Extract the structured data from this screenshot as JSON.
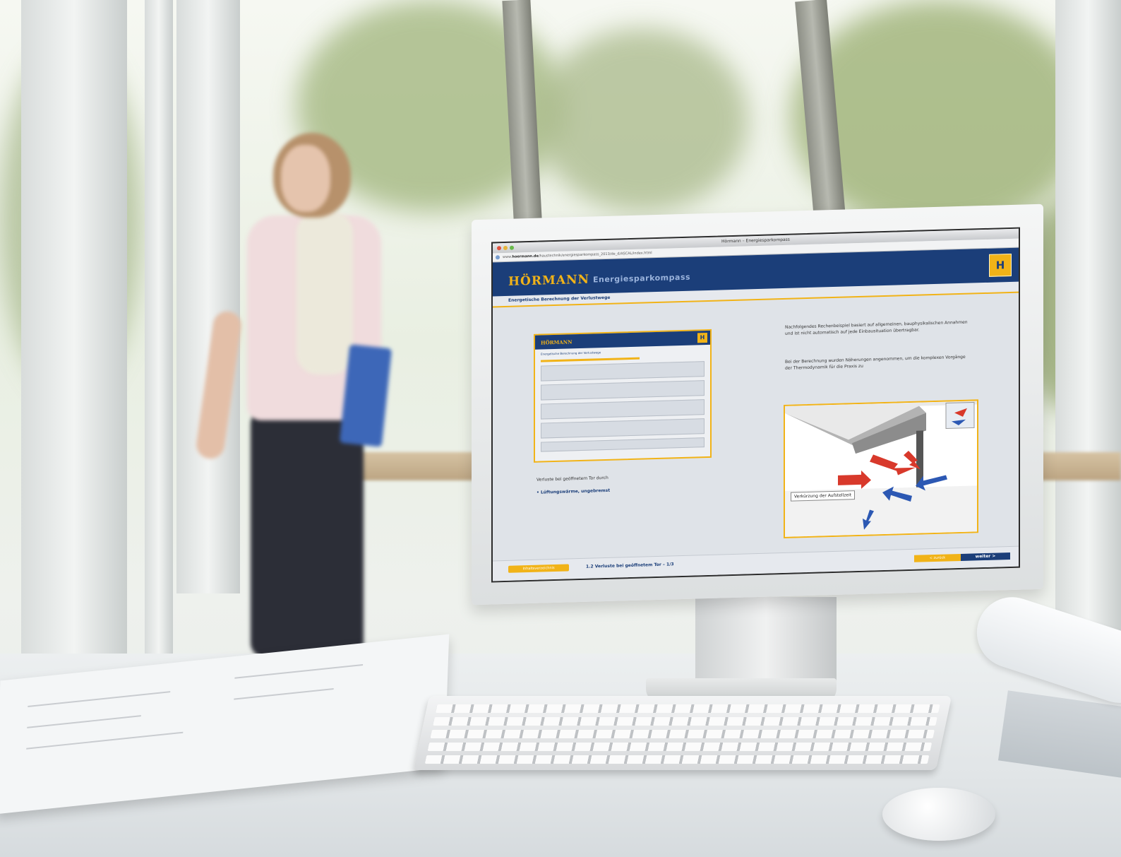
{
  "browser": {
    "window_title": "Hörmann – Energiesparkompass",
    "url_prefix": "www.",
    "url_domain": "hoermann.de",
    "url_path": "/haustechnik/energiesparkompass_2013/de_d/ASCAL/index.html"
  },
  "app": {
    "brand": "HÖRMANN",
    "product": "Energiesparkompass",
    "logo_glyph": "H",
    "section_title": "Energetische Berechnung der Verlustwege",
    "thumbnail": {
      "brand": "HÖRMANN",
      "logo_glyph": "H",
      "title": "Energetische Berechnung der Verlustwege"
    },
    "loss_intro": "Verluste bei geöffnetem Tor durch",
    "loss_item": "Lüftungswärme, ungebremst",
    "paragraph_1": "Nachfolgendes Rechenbeispiel basiert auf allgemeinen, bauphysikalischen Annahmen und ist nicht automatisch auf jede Einbausituation übertragbar.",
    "paragraph_2": "Bei der Berechnung wurden Näherungen angenommen, um die komplexen Vorgänge der Thermodynamik für die Praxis zu",
    "diagram_caption": "Verkürzung der Aufstellzeit",
    "footer": {
      "left_button": "Inhaltsverzeichnis",
      "page_info": "1.2 Verluste bei geöffnetem Tor – 1/3",
      "back_button": "< zurück",
      "next_button": "weiter >"
    }
  },
  "colors": {
    "brand_blue": "#1b3e79",
    "brand_yellow": "#f1b318"
  }
}
